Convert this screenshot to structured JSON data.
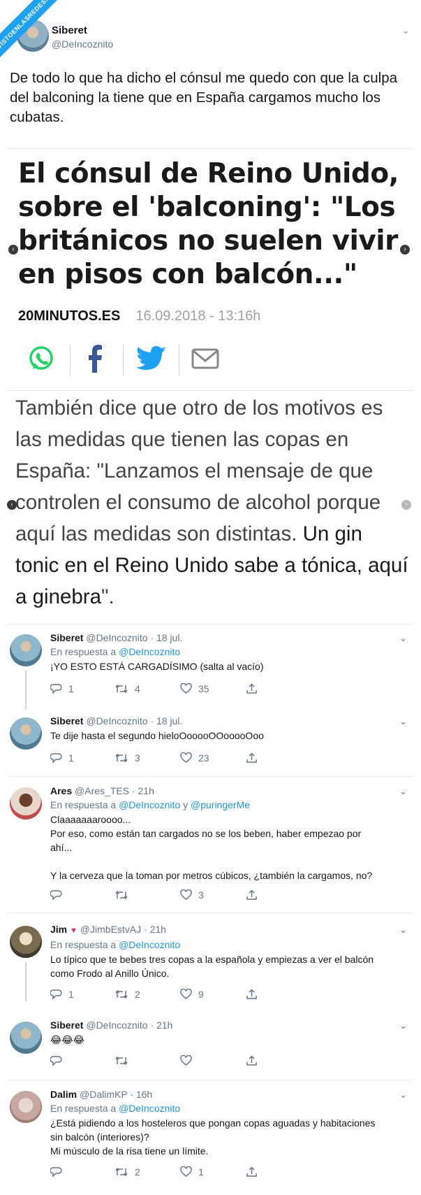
{
  "ribbon": "VISTOENLASREDES.com",
  "main_tweet": {
    "name": "Siberet",
    "handle": "@DeIncoznito",
    "text": "De todo lo que ha dicho el cónsul me quedo con que la culpa del balconing la tiene que en España cargamos mucho los cubatas."
  },
  "article": {
    "headline": "El cónsul de Reino Unido, sobre el 'balconing': \"Los británicos no suelen vivir en pisos con balcón...\"",
    "source": "20MINUTOS.ES",
    "date": "16.09.2018 - 13:16h",
    "share_icons": [
      "whatsapp-icon",
      "facebook-icon",
      "twitter-icon",
      "email-icon"
    ],
    "body_plain": "También dice que otro de los motivos es las medidas que tienen las copas en España: \"Lanzamos el mensaje de que controlen el consumo de alcohol porque aquí las medidas son distintas.",
    "body_bold": "Un gin tonic en el Reino Unido sabe a tónica, aquí a ginebra",
    "body_end": "\"."
  },
  "replies": [
    {
      "name": "Siberet",
      "handle": "@DeIncoznito",
      "time": "18 jul.",
      "reply_prefix": "En respuesta a ",
      "reply_to": "@DeIncoznito",
      "reply_and": "",
      "reply_to2": "",
      "lines": [
        "¡YO ESTO ESTÁ CARGADÍSIMO (salta al vacío)"
      ],
      "replies_count": "1",
      "retweets": "4",
      "likes": "35"
    },
    {
      "name": "Siberet",
      "handle": "@DeIncoznito",
      "time": "18 jul.",
      "reply_prefix": "",
      "reply_to": "",
      "reply_and": "",
      "reply_to2": "",
      "lines": [
        "Te dije hasta el segundo hieloOooooOOooooOoo"
      ],
      "replies_count": "1",
      "retweets": "3",
      "likes": "23"
    },
    {
      "name": "Ares",
      "handle": "@Ares_TES",
      "time": "21h",
      "reply_prefix": "En respuesta a ",
      "reply_to": "@DeIncoznito",
      "reply_and": " y ",
      "reply_to2": "@puringerMe",
      "lines": [
        "Claaaaaaaroooo...",
        "Por eso, como están tan cargados no se los beben, haber empezao por",
        "ahí...",
        "",
        "Y la cerveza que la toman por metros cúbicos, ¿también la cargamos, no?"
      ],
      "replies_count": "",
      "retweets": "",
      "likes": "3"
    },
    {
      "name": "Jim",
      "handle": "@JimbEstvAJ",
      "time": "21h",
      "reply_prefix": "En respuesta a ",
      "reply_to": "@DeIncoznito",
      "reply_and": "",
      "reply_to2": "",
      "lines": [
        "Lo típico que te bebes tres copas a la española y empiezas a ver el balcón",
        "como Frodo al Anillo Único."
      ],
      "replies_count": "1",
      "retweets": "2",
      "likes": "9"
    },
    {
      "name": "Siberet",
      "handle": "@DeIncoznito",
      "time": "21h",
      "reply_prefix": "",
      "reply_to": "",
      "reply_and": "",
      "reply_to2": "",
      "lines": [
        "😂😂😂"
      ],
      "replies_count": "",
      "retweets": "",
      "likes": ""
    },
    {
      "name": "Dalim",
      "handle": "@DalimKP",
      "time": "16h",
      "reply_prefix": "En respuesta a ",
      "reply_to": "@DeIncoznito",
      "reply_and": "",
      "reply_to2": "",
      "lines": [
        "¿Está pidiendo a los hosteleros que pongan copas aguadas y habitaciones",
        "sin balcón (interiores)?",
        "Mi músculo de la risa tiene un límite."
      ],
      "replies_count": "",
      "retweets": "2",
      "likes": "1"
    }
  ],
  "colors": {
    "accent": "#1da1f2",
    "mention": "#1b95e0",
    "muted": "#657786",
    "whatsapp": "#25d366",
    "facebook": "#3b5998",
    "twitter": "#1da1f2",
    "jim_flag": "#e0245e"
  }
}
